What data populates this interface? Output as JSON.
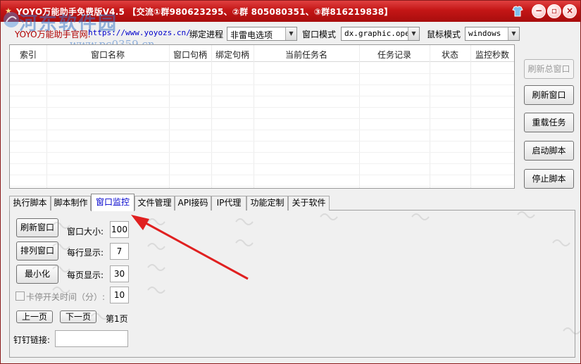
{
  "window": {
    "title": "YOYO万能助手免费版V4.5  【交流①群980623295、②群 805080351、③群816219838】",
    "buttons": {
      "minimize": "−",
      "maximize": "▫",
      "close": "×"
    }
  },
  "watermark": {
    "text": "河东软件园",
    "url": "www.pc0359.cn"
  },
  "toolbar": {
    "site_label": "YOYO万能助手官网:",
    "site_url": "https://www.yoyozs.cn/",
    "bind_process_label": "绑定进程",
    "bind_process_value": "非雷电选项",
    "window_mode_label": "窗口模式",
    "window_mode_value": "dx.graphic.open",
    "mouse_mode_label": "鼠标模式",
    "mouse_mode_value": "windows"
  },
  "table": {
    "columns": [
      "索引",
      "窗口名称",
      "窗口句柄",
      "绑定句柄",
      "当前任务名",
      "任务记录",
      "状态",
      "监控秒数"
    ],
    "rows": []
  },
  "side_buttons": {
    "refresh_total": "刷新总窗口",
    "refresh_window": "刷新窗口",
    "reload_task": "重载任务",
    "start_script": "启动脚本",
    "stop_script": "停止脚本"
  },
  "tabs": [
    {
      "label": "执行脚本"
    },
    {
      "label": "脚本制作"
    },
    {
      "label": "窗口监控"
    },
    {
      "label": "文件管理"
    },
    {
      "label": "API接码"
    },
    {
      "label": "IP代理"
    },
    {
      "label": "功能定制"
    },
    {
      "label": "关于软件"
    }
  ],
  "active_tab": "窗口监控",
  "monitor": {
    "refresh_button": "刷新窗口",
    "arrange_button": "排列窗口",
    "minimize_button": "最小化",
    "window_size_label": "窗口大小:",
    "window_size_value": "100",
    "per_row_label": "每行显示:",
    "per_row_value": "7",
    "per_page_label": "每页显示:",
    "per_page_value": "30",
    "stuck_label": "卡停开关时间（分）:",
    "stuck_value": "10",
    "prev_button": "上一页",
    "next_button": "下一页",
    "page_label": "第1页",
    "dingtalk_label": "钉钉链接:",
    "dingtalk_value": ""
  },
  "colors": {
    "titlebar": "#c41616",
    "accent_link": "#0000cc",
    "arrow": "#e02020"
  }
}
